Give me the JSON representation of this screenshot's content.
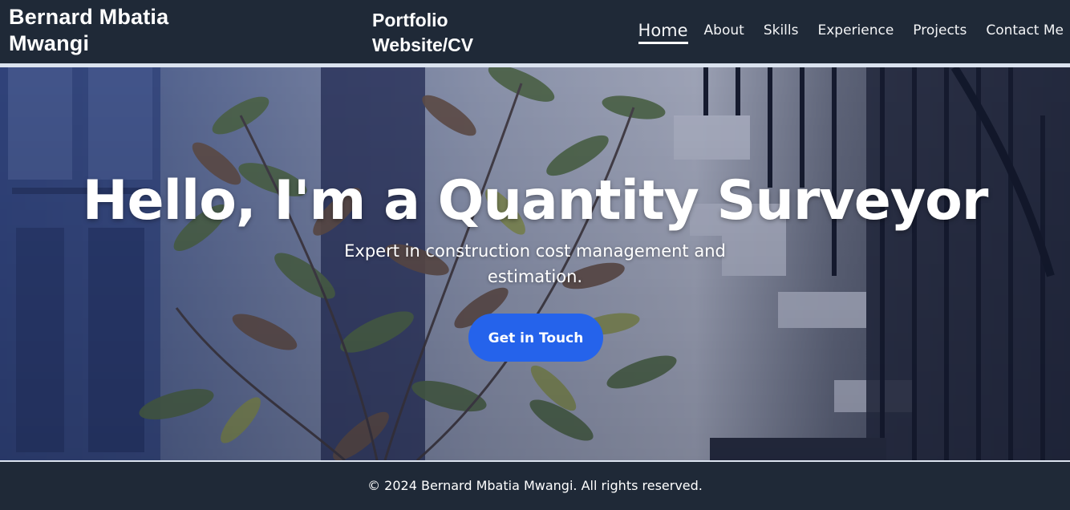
{
  "header": {
    "brand": "Bernard Mbatia Mwangi",
    "subtitle": "Portfolio Website/CV",
    "nav": [
      {
        "label": "Home",
        "active": true
      },
      {
        "label": "About",
        "active": false
      },
      {
        "label": "Skills",
        "active": false
      },
      {
        "label": "Experience",
        "active": false
      },
      {
        "label": "Projects",
        "active": false
      },
      {
        "label": "Contact Me",
        "active": false
      }
    ]
  },
  "hero": {
    "title": "Hello, I'm a Quantity Surveyor",
    "subtitle": "Expert in construction cost management and estimation.",
    "cta_label": "Get in Touch",
    "background_image": "photo of plants beside a white building stairway with dark railings"
  },
  "footer": {
    "text": "© 2024 Bernard Mbatia Mwangi. All rights reserved."
  },
  "colors": {
    "header_bg": "#1f2937",
    "accent": "#2563eb",
    "text": "#ffffff",
    "divider": "#dbe3ef"
  }
}
